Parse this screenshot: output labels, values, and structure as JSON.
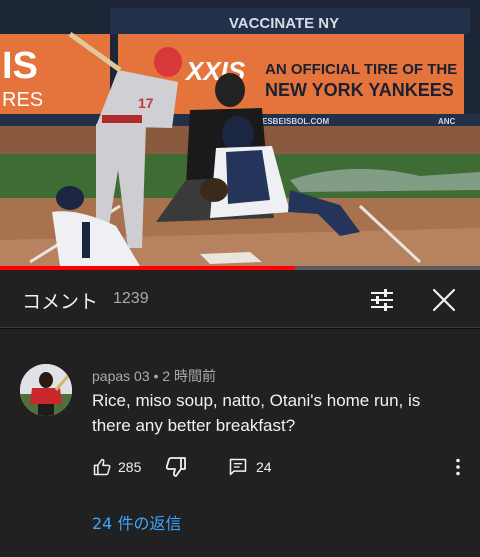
{
  "video": {
    "ad_banner_top": "VACCINATE NY",
    "ad_left_text": "IS",
    "ad_left_text2": "RES",
    "ad_brand_fragment": "XXIS",
    "ad_line1": "AN OFFICIAL TIRE OF THE",
    "ad_line2": "NEW YORK YANKEES",
    "ad_url": "ESBEISBOL.COM",
    "ad_logo_text": "ANC",
    "pitcher_number": "17",
    "progress_fraction": 0.615
  },
  "comments_panel": {
    "title": "コメント",
    "count": "1239"
  },
  "comment": {
    "author": "papas 03",
    "separator": "•",
    "time": "2 時間前",
    "text": "Rice, miso soup, natto, Otani's home run, is there any better breakfast?",
    "likes": "285",
    "replies_count": "24",
    "replies_link": "24 件の返信"
  },
  "colors": {
    "background": "#212121",
    "link": "#3ea6ff",
    "progress": "#ff0000"
  },
  "icons": {
    "filter": "sliders-icon",
    "close": "close-icon",
    "like": "thumbs-up-icon",
    "dislike": "thumbs-down-icon",
    "reply": "comment-icon",
    "more": "more-vert-icon"
  }
}
